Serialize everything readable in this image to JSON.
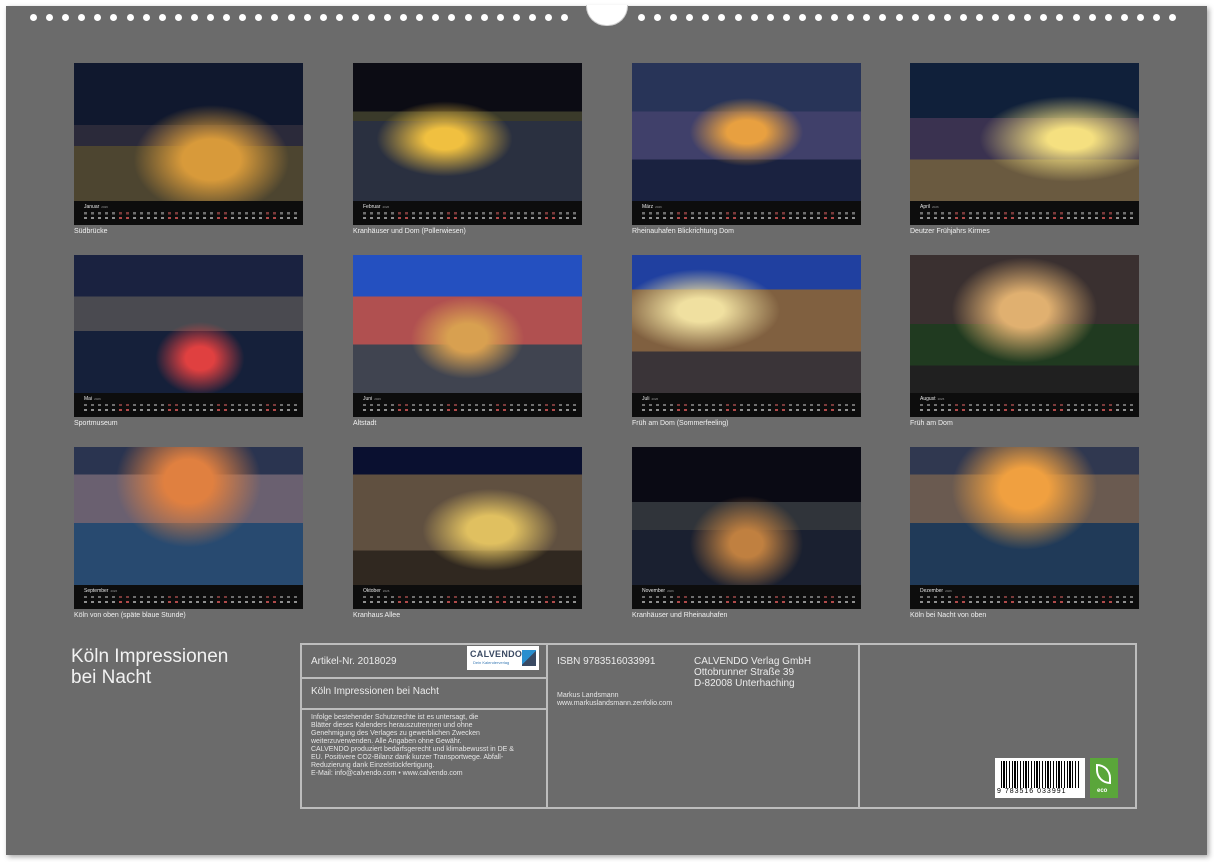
{
  "months": [
    {
      "name": "Januar",
      "year": "2026",
      "caption": "Südbrücke"
    },
    {
      "name": "Februar",
      "year": "2026",
      "caption": "Kranhäuser und Dom (Pollerwiesen)"
    },
    {
      "name": "März",
      "year": "2026",
      "caption": "Rheinauhafen Blickrichtung Dom"
    },
    {
      "name": "April",
      "year": "2026",
      "caption": "Deutzer Frühjahrs Kirmes"
    },
    {
      "name": "Mai",
      "year": "2026",
      "caption": "Sportmuseum"
    },
    {
      "name": "Juni",
      "year": "2026",
      "caption": "Altstadt"
    },
    {
      "name": "Juli",
      "year": "2026",
      "caption": "Früh am Dom (Sommerfeeling)"
    },
    {
      "name": "August",
      "year": "2026",
      "caption": "Früh am Dom"
    },
    {
      "name": "September",
      "year": "2026",
      "caption": "Köln von oben (späte blaue Stunde)"
    },
    {
      "name": "Oktober",
      "year": "2026",
      "caption": "Kranhaus Allee"
    },
    {
      "name": "November",
      "year": "2026",
      "caption": "Kranhäuser und Rheinauhafen"
    },
    {
      "name": "Dezember",
      "year": "2026",
      "caption": "Köln bei Nacht von oben"
    }
  ],
  "title_line1": "Köln Impressionen",
  "title_line2": "bei Nacht",
  "info": {
    "article": "Artikel-Nr. 2018029",
    "calendar_title": "Köln Impressionen bei Nacht",
    "legal": [
      "Infolge bestehender Schutzrechte ist es untersagt, die",
      "Blätter dieses Kalenders herauszutrennen und ohne",
      "Genehmigung des Verlages zu gewerblichen Zwecken",
      "weiterzuverwenden. Alle Angaben ohne Gewähr.",
      "CALVENDO produziert bedarfsgerecht und klimabewusst in DE &",
      "EU. Positivere CO2-Bilanz dank kurzer Transportwege. Abfall-",
      "Reduzierung dank Einzelstückfertigung.",
      "E-Mail: info@calvendo.com • www.calvendo.com"
    ],
    "isbn": "ISBN 9783516033991",
    "publisher": [
      "CALVENDO Verlag GmbH",
      "Ottobrunner Straße 39",
      "D-82008 Unterhaching"
    ],
    "author": "Markus Landsmann",
    "author_url": "www.markuslandsmann.zenfolio.com",
    "logo_word": "CALVENDO",
    "logo_sub": "Dein Kalenderverlag",
    "barcode_digits": "9 783516 033991",
    "eco_label": "eco"
  }
}
